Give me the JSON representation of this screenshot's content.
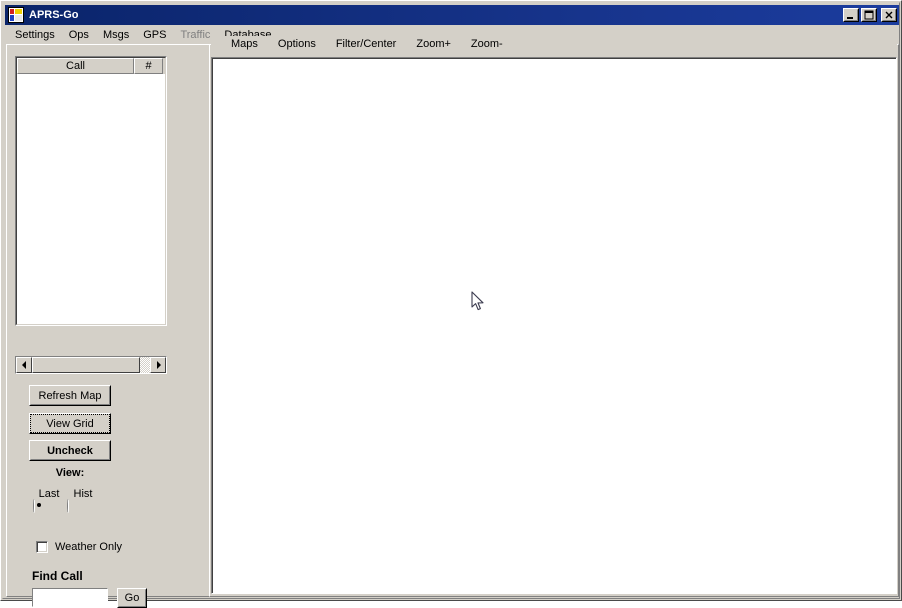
{
  "window": {
    "title": "APRS-Go",
    "icon": "aprs-app-icon",
    "controls": {
      "minimize": "minimize-icon",
      "maximize": "maximize-icon",
      "close": "close-icon"
    }
  },
  "menubar": {
    "items": [
      {
        "label": "Settings",
        "disabled": false
      },
      {
        "label": "Ops",
        "disabled": false
      },
      {
        "label": "Msgs",
        "disabled": false
      },
      {
        "label": "GPS",
        "disabled": false
      },
      {
        "label": "Traffic",
        "disabled": true
      },
      {
        "label": "Database",
        "disabled": false
      }
    ]
  },
  "map_menubar": {
    "items": [
      {
        "label": "Maps"
      },
      {
        "label": "Options"
      },
      {
        "label": "Filter/Center"
      },
      {
        "label": "Zoom+"
      },
      {
        "label": "Zoom-"
      }
    ]
  },
  "sidebar": {
    "call_list": {
      "columns": [
        {
          "label": "Call"
        },
        {
          "label": "#"
        }
      ],
      "rows": []
    },
    "scrollbar": {
      "left_arrow": "scroll-left-icon",
      "right_arrow": "scroll-right-icon"
    },
    "buttons": {
      "refresh_map": "Refresh Map",
      "view_grid": "View Grid",
      "uncheck": "Uncheck",
      "go": "Go"
    },
    "view": {
      "label": "View:",
      "options": [
        {
          "label": "Last",
          "checked": true
        },
        {
          "label": "Hist",
          "checked": false
        }
      ]
    },
    "weather_only": {
      "label": "Weather Only",
      "checked": false
    },
    "find_call": {
      "label": "Find Call",
      "value": "",
      "placeholder": ""
    }
  },
  "map": {
    "background": "#ffffff",
    "content": ""
  },
  "colors": {
    "title_bar": "#0a246a",
    "window_face": "#d4d0c8",
    "map_background": "#ffffff",
    "disabled_text": "#808080"
  }
}
